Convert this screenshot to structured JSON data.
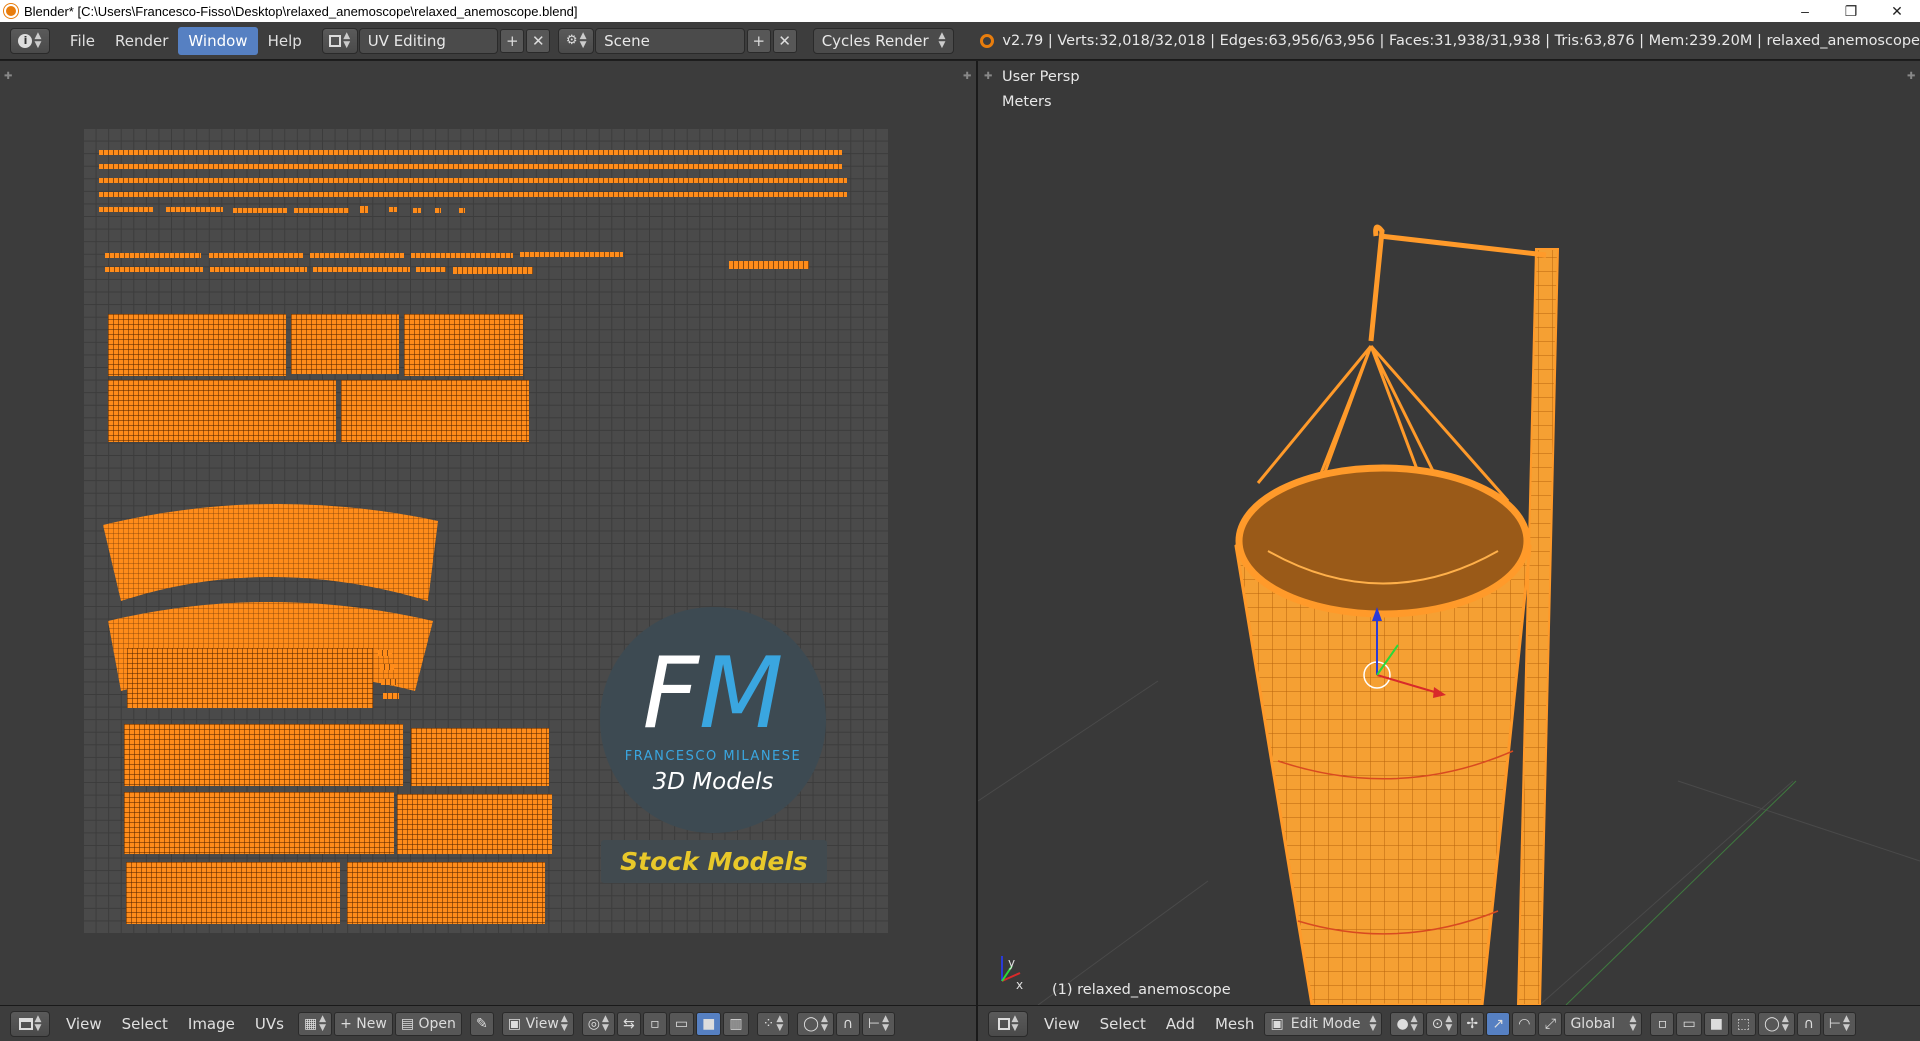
{
  "window": {
    "title": "Blender* [C:\\Users\\Francesco-Fisso\\Desktop\\relaxed_anemoscope\\relaxed_anemoscope.blend]",
    "minimize_glyph": "–",
    "maximize_glyph": "❐",
    "close_glyph": "✕"
  },
  "info_header": {
    "editor_icon": "info-icon",
    "menus": [
      "File",
      "Render",
      "Window",
      "Help"
    ],
    "active_menu": "Window",
    "screen_layout": "UV Editing",
    "scene": "Scene",
    "render_engine": "Cycles Render",
    "stats": "v2.79 | Verts:32,018/32,018 | Edges:63,956/63,956 | Faces:31,938/31,938 | Tris:63,876 | Mem:239.20M | relaxed_anemoscope",
    "add_glyph": "+",
    "remove_glyph": "✕"
  },
  "uv_editor": {
    "watermark": {
      "letter_f": "F",
      "letter_m": "M",
      "subtitle": "FRANCESCO MILANESE",
      "tagline": "3D Models",
      "badge": "Stock Models"
    },
    "footer": {
      "menus": [
        "View",
        "Select",
        "Image",
        "UVs"
      ],
      "new_label": "New",
      "open_label": "Open",
      "view_label": "View"
    }
  },
  "viewport": {
    "view_label": "User Persp",
    "units_label": "Meters",
    "object_label": "(1) relaxed_anemoscope",
    "axis_y": "y",
    "axis_x": "x",
    "footer": {
      "menus": [
        "View",
        "Select",
        "Add",
        "Mesh"
      ],
      "mode": "Edit Mode",
      "orientation": "Global"
    }
  },
  "colors": {
    "accent_selected": "#5680c2",
    "uv_orange": "#ff8c1a",
    "blender_orange": "#e87d0d",
    "logo_blue": "#3aa6e0",
    "badge_yellow": "#e8c82a"
  }
}
